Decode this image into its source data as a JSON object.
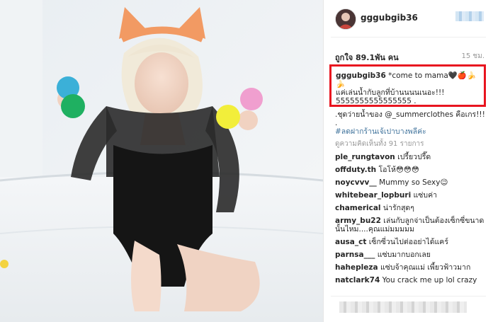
{
  "post": {
    "username": "gggubgib36",
    "likes": "ถูกใจ 89.1พัน คน",
    "time": "15 ชม.",
    "caption": {
      "user": "gggubgib36",
      "text_line1": "*come to mama🖤🍎🍌🍌",
      "text_line2": "แค่เล่นน้ำกับลูกที่บ้านนนนเนอะ!!!",
      "text_line3": "5555555555555555 ."
    }
  },
  "comments": [
    {
      "user": "",
      "text": ".ชุดว่ายน้ำของ @_summerclothes คือเกร!!! .",
      "tag": "#ลดฝากร้านเจ้เปาบางพลีค่ะ"
    },
    {
      "user": "",
      "text": "ดูความคิดเห็นทั้ง 91 รายการ"
    },
    {
      "user": "ple_rungtavon",
      "text": "เปรี้ยวปรี๊ด"
    },
    {
      "user": "offduty.th",
      "text": "โอโห้😳😳😳"
    },
    {
      "user": "noycvvv__",
      "text": "Mummy so Sexy😉"
    },
    {
      "user": "whitebear_lopburi",
      "text": "แซ่บค่า"
    },
    {
      "user": "chamerical",
      "text": "น่ารักสุดๆ"
    },
    {
      "user": "army_bu22",
      "text": "เล่นกับลูกจ่าเป็นต้องเซ็กซี่ขนาดนั้นไหม....คุณแม่มมมมม"
    },
    {
      "user": "ausa_ct",
      "text": "เซ็กซี่วนไปต่ออย่าได้แคร์"
    },
    {
      "user": "parnsa___",
      "text": "แซ่บมากบอกเลย"
    },
    {
      "user": "haheplеza",
      "text": "แซ่บจ้าคุณแม่ เพี้ยวฟ้าวมาก"
    },
    {
      "user": "natclark74",
      "text": "You crack me up lol crazy"
    }
  ],
  "colors": {
    "highlight": "#e8141f",
    "link": "#3f729b"
  }
}
